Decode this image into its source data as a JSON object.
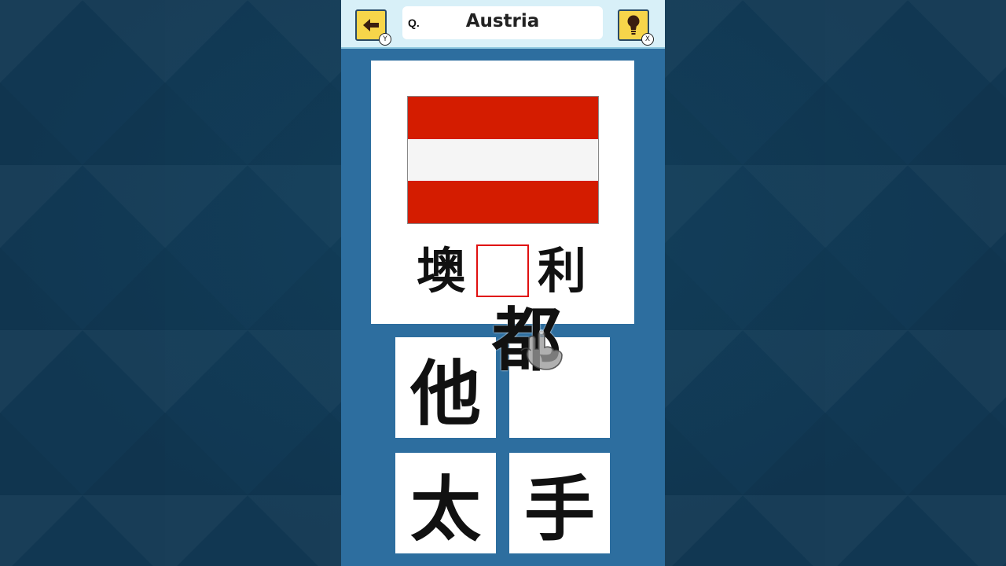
{
  "header": {
    "back_button_badge": "Y",
    "hint_button_badge": "X",
    "question_prefix": "Q.",
    "question_text": "Austria"
  },
  "puzzle": {
    "flag_colors": [
      "#d41c00",
      "#f5f5f5",
      "#d41c00"
    ],
    "word_left": "墺",
    "word_blank": "",
    "word_right": "利",
    "blank_border_color": "#e01010"
  },
  "dragged_tile": "都",
  "choices": [
    "他",
    "",
    "太",
    "手"
  ],
  "colors": {
    "panel": "#2d6e9f",
    "topbar": "#d8f0f8",
    "button": "#f7d54a"
  },
  "icons": {
    "back": "arrow-left-icon",
    "hint": "lightbulb-icon",
    "pointer": "hand-pointer-icon"
  }
}
